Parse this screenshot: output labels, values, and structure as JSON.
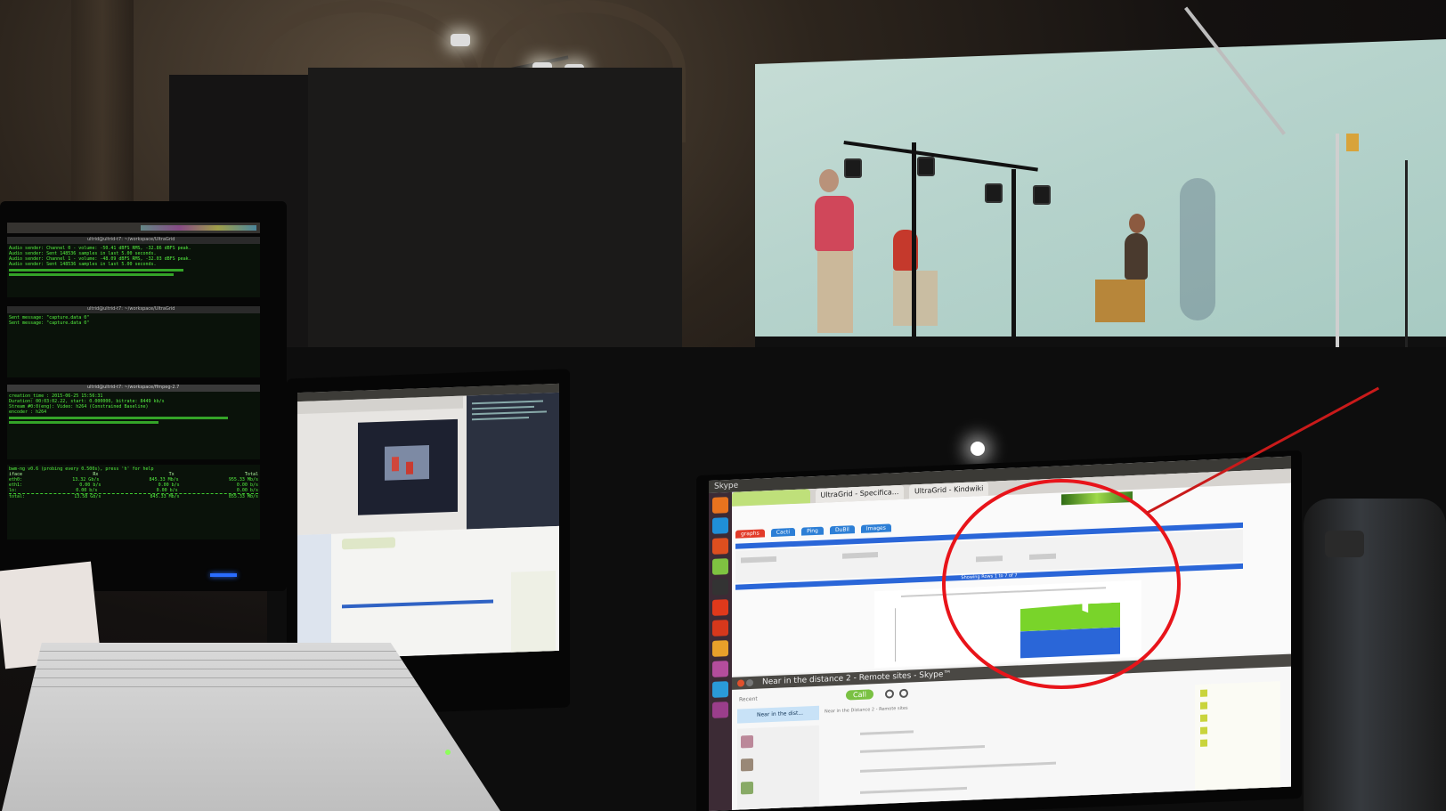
{
  "scene": {
    "left_monitor": {
      "terminal_titles": [
        "ultrid@ultrid-t7: ~/workspace/UltraGrid",
        "ultrid@ultrid-t7: ~/workspace/UltraGrid",
        "ultrid@ultrid-t7: ~/workspace/ffmpeg-2.7"
      ],
      "top_lines": [
        "Audio sender: Channel 0 - volume: -50.41 dBFS RMS, -32.86 dBFS peak.",
        "Audio sender: Sent 148536 samples in last 5.00 seconds.",
        "Audio sender: Channel 1 - volume: -48.09 dBFS RMS, -32.03 dBFS peak.",
        "Audio sender: Sent 148536 samples in last 5.00 seconds."
      ],
      "mid_lines": [
        "Sent message: \"capture.data 0\"",
        "Sent message: \"capture.data 0\""
      ],
      "ffmpeg_lines": [
        "creation_time : 2015-06-25 15:56:31",
        "Duration: 00:03:02.22, start: 0.000000, bitrate: 8449 kb/s",
        "Stream #0:0(eng): Video: h264 (Constrained Baseline)",
        "encoder : h264"
      ],
      "bwm_header": "bwm-ng v0.6 (probing every 0.500s), press 'h' for help",
      "bwm_cols": [
        "iface",
        "Rx",
        "Tx",
        "Total"
      ],
      "bwm_rows": [
        [
          "eth0:",
          "13.32 Gb/s",
          "845.33 Mb/s",
          "955.33 Mb/s"
        ],
        [
          "eth1:",
          "0.00 b/s",
          "0.00 b/s",
          "0.00 b/s"
        ],
        [
          "lo:",
          "0.00 b/s",
          "0.00 b/s",
          "0.00 b/s"
        ],
        [
          "total:",
          "13.58 Gb/s",
          "845.33 Mb/s",
          "855.33 Mb/s"
        ]
      ]
    },
    "skype_laptop": {
      "panel_app": "Skype",
      "browser_tabs": [
        "UltraGrid - Specifica...",
        "UltraGrid - Kindwiki"
      ],
      "page_tabs": [
        "graphs",
        "Cacti",
        "Ping",
        "DuBil",
        "Images"
      ],
      "graph_band_label": "Showing Rows 1 to 7 of 7",
      "skype_window_title": "Near in the distance 2 - Remote sites - Skype™",
      "recent_label": "Recent",
      "call_label": "Call",
      "conversation_item": "Near in the dist...",
      "conversation_header": "Near in the Distance 2 - Remote sites",
      "graph": {
        "green_series_color": "#79d42a",
        "blue_series_color": "#2a66d8"
      }
    },
    "annotation": {
      "ring_color": "#e8141a"
    }
  }
}
